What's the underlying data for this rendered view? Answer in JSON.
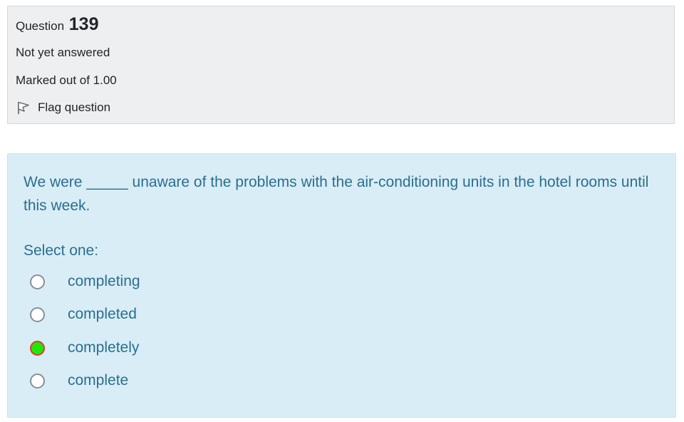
{
  "info": {
    "question_word": "Question",
    "question_number": "139",
    "state": "Not yet answered",
    "grade": "Marked out of 1.00",
    "flag_label": "Flag question"
  },
  "question": {
    "text": "We were _____ unaware of the problems with the air-conditioning units in the hotel rooms until this week.",
    "prompt": "Select one:",
    "answers": [
      {
        "label": "completing",
        "selected": false
      },
      {
        "label": "completed",
        "selected": false
      },
      {
        "label": "completely",
        "selected": true
      },
      {
        "label": "complete",
        "selected": false
      }
    ]
  },
  "colors": {
    "info_background": "#eeeff0",
    "question_background": "#d9edf7",
    "question_text": "#2a6f8d",
    "selected_radio_fill": "#22e60a",
    "selected_radio_border": "#d9412c"
  }
}
